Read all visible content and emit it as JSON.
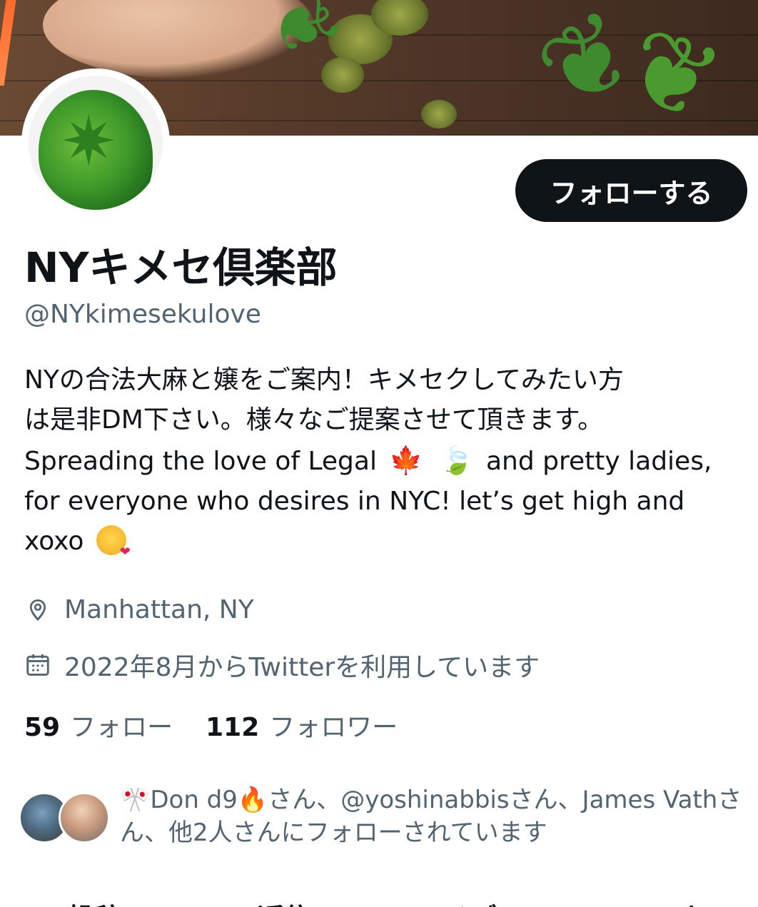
{
  "profile": {
    "follow_button_label": "フォローする",
    "display_name": "NYキメセ倶楽部",
    "handle": "@NYkimesekulove",
    "bio": {
      "line1": "NYの合法大麻と嬢をご案内！キメセクしてみたい方",
      "line2": "は是非DM下さい。様々なご提案させて頂きます。",
      "line3_a": "Spreading the love of Legal",
      "line3_emoji1": "🍁",
      "line3_emoji2": "🍃",
      "line3_b": "and pretty ladies,",
      "line4": "for everyone who desires in NYC! let’s get high and",
      "line5": "xoxo"
    },
    "location": "Manhattan, NY",
    "joined": "2022年8月からTwitterを利用しています",
    "following_count": "59",
    "following_label": "フォロー",
    "followers_count": "112",
    "followers_label": "フォロワー",
    "followed_by": {
      "line1": "🎌Don d9🔥さん、@yoshinabbisさん、James Vathさ",
      "line2": "ん、他2人さんにフォローされています"
    }
  },
  "tabs": [
    "投稿",
    "返信",
    "メディア",
    "いいね"
  ],
  "icons": {
    "location": "map-pin-icon",
    "calendar": "calendar-icon"
  },
  "colors": {
    "primary_text": "#0f1419",
    "secondary_text": "#536471",
    "button_bg": "#0f1419"
  }
}
